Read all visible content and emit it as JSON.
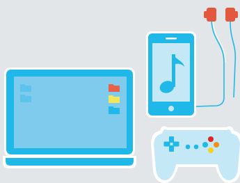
{
  "palette": {
    "background": "#e2e6e9",
    "device_blue": "#1fb8e8",
    "screen_blue": "#7ecbee",
    "phone_screen": "#c4e8f6",
    "white": "#ffffff",
    "folder_blue": "#1fb8e8",
    "folder_red": "#e8604a",
    "folder_yellow": "#f2e65a",
    "earbud_red": "#e2573e",
    "controller_body": "#c4e8f6",
    "button_red": "#e02424",
    "button_orange": "#f29018",
    "button_yellow": "#f7d21a",
    "button_blue": "#1fb8e8"
  },
  "items": [
    {
      "id": "laptop",
      "icon": "laptop-icon"
    },
    {
      "id": "phone",
      "icon": "smartphone-icon"
    },
    {
      "id": "screen_icon",
      "icon": "music-note-icon"
    },
    {
      "id": "earphones",
      "icon": "earphones-icon"
    },
    {
      "id": "controller",
      "icon": "gamepad-icon"
    }
  ],
  "laptop_folders": [
    {
      "icon": "folder-icon",
      "color": "folder_blue"
    },
    {
      "icon": "folder-icon",
      "color": "folder_blue"
    },
    {
      "icon": "folder-icon",
      "color": "folder_red"
    },
    {
      "icon": "folder-icon",
      "color": "folder_yellow"
    },
    {
      "icon": "folder-icon",
      "color": "folder_blue"
    }
  ]
}
